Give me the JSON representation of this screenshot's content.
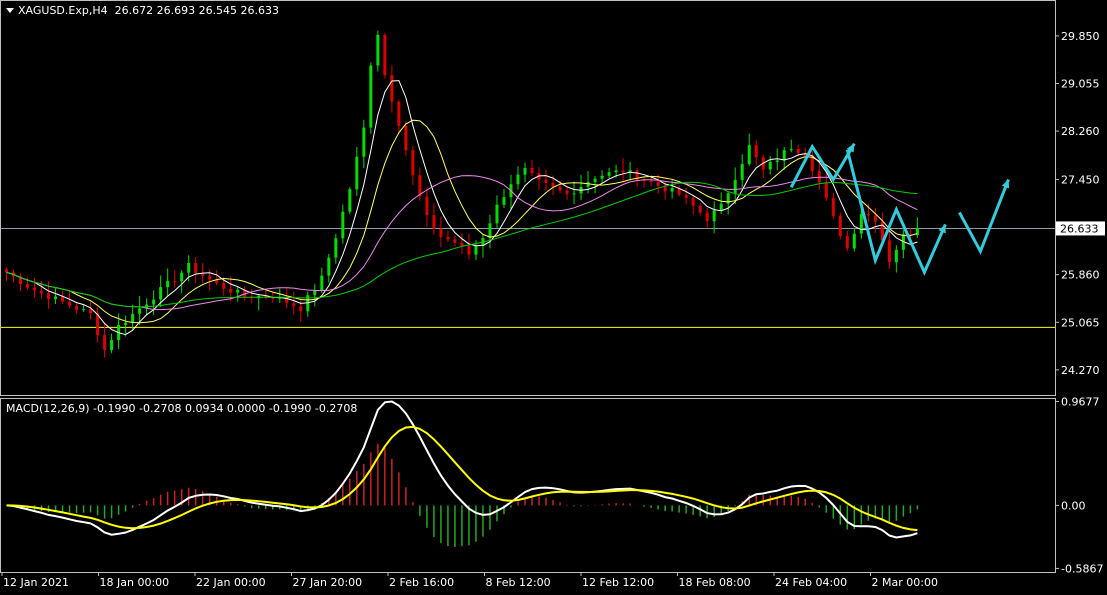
{
  "symbol_header": "XAGUSD.Exp,H4  26.672 26.693 26.545 26.633",
  "macd_header": "MACD(12,26,9) -0.1990 -0.2708 0.0934 0.0000 -0.1990 -0.2708",
  "current_price_label": "26.633",
  "colors": {
    "background": "#000000",
    "bull_candle": "#00dd00",
    "bear_candle": "#dd0000",
    "ma_fast": "#ffffff",
    "ma_mid": "#ffff66",
    "ma_slow": "#ee88ee",
    "ma_long": "#00cc00",
    "macd_line": "#ffffff",
    "signal_line": "#ffff00",
    "hist_pos": "#cc2222",
    "hist_neg": "#22aa22",
    "support_line": "#ffff00",
    "arrows": "#33ccdd",
    "grid_frame": "#c0c0c0"
  },
  "chart_data": [
    {
      "type": "candlestick",
      "title": "XAGUSD.Exp,H4",
      "y_ticks": [
        "29.850",
        "29.055",
        "28.260",
        "27.450",
        "26.633",
        "25.860",
        "25.065",
        "24.270"
      ],
      "ylim": [
        23.85,
        30.45
      ],
      "x_ticks": [
        "12 Jan 2021",
        "18 Jan 00:00",
        "22 Jan 00:00",
        "27 Jan 20:00",
        "2 Feb 16:00",
        "8 Feb 12:00",
        "12 Feb 12:00",
        "18 Feb 08:00",
        "24 Feb 04:00",
        "2 Mar 00:00"
      ],
      "last_price": 26.633,
      "support_level": 24.98,
      "price_path": [
        [
          0,
          25.9
        ],
        [
          4,
          25.6
        ],
        [
          8,
          25.4
        ],
        [
          12,
          25.2
        ],
        [
          14,
          24.6
        ],
        [
          16,
          25.0
        ],
        [
          20,
          25.4
        ],
        [
          24,
          25.8
        ],
        [
          26,
          26.0
        ],
        [
          30,
          25.7
        ],
        [
          34,
          25.5
        ],
        [
          38,
          25.5
        ],
        [
          42,
          25.3
        ],
        [
          45,
          25.8
        ],
        [
          47,
          26.5
        ],
        [
          49,
          27.3
        ],
        [
          51,
          28.3
        ],
        [
          52,
          29.4
        ],
        [
          53,
          29.9
        ],
        [
          54,
          29.2
        ],
        [
          56,
          28.4
        ],
        [
          58,
          27.5
        ],
        [
          60,
          26.8
        ],
        [
          62,
          26.5
        ],
        [
          64,
          26.4
        ],
        [
          66,
          26.2
        ],
        [
          68,
          26.5
        ],
        [
          70,
          27.0
        ],
        [
          72,
          27.4
        ],
        [
          74,
          27.6
        ],
        [
          76,
          27.4
        ],
        [
          78,
          27.3
        ],
        [
          80,
          27.2
        ],
        [
          84,
          27.5
        ],
        [
          88,
          27.6
        ],
        [
          92,
          27.4
        ],
        [
          96,
          27.2
        ],
        [
          98,
          27.0
        ],
        [
          100,
          26.8
        ],
        [
          102,
          27.0
        ],
        [
          104,
          27.5
        ],
        [
          106,
          28.0
        ],
        [
          108,
          27.6
        ],
        [
          110,
          27.8
        ],
        [
          112,
          28.0
        ],
        [
          114,
          27.9
        ],
        [
          116,
          27.4
        ],
        [
          118,
          26.8
        ],
        [
          120,
          26.3
        ],
        [
          122,
          26.9
        ],
        [
          124,
          26.8
        ],
        [
          126,
          26.1
        ],
        [
          128,
          26.5
        ],
        [
          130,
          26.633
        ]
      ],
      "moving_averages": [
        {
          "name": "ma_fast",
          "color_key": "ma_fast",
          "period": 5
        },
        {
          "name": "ma_mid",
          "color_key": "ma_mid",
          "period": 10
        },
        {
          "name": "ma_slow",
          "color_key": "ma_slow",
          "period": 20
        },
        {
          "name": "ma_long",
          "color_key": "ma_long",
          "period": 50
        }
      ],
      "projection_arrows": [
        [
          [
            112,
            27.32
          ],
          [
            115,
            28.0
          ],
          [
            118,
            27.45
          ],
          [
            121,
            28.05
          ]
        ],
        [
          [
            120,
            27.95
          ],
          [
            124,
            26.1
          ],
          [
            127,
            26.95
          ],
          [
            131,
            25.9
          ],
          [
            134,
            26.7
          ]
        ],
        [
          [
            136,
            26.9
          ],
          [
            139,
            26.25
          ],
          [
            143,
            27.45
          ]
        ]
      ]
    },
    {
      "type": "macd",
      "title": "MACD(12,26,9)",
      "y_ticks": [
        "0.9677",
        "0.00",
        "-0.5867"
      ],
      "ylim": [
        -0.62,
        1.0
      ],
      "macd": -0.199,
      "signal": -0.2708,
      "histogram": 0.0934
    }
  ]
}
